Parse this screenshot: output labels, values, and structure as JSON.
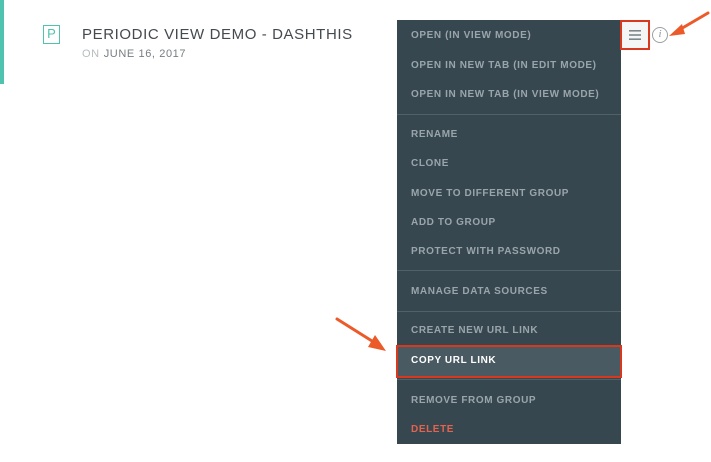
{
  "dashboard": {
    "letter": "P",
    "title": "PERIODIC VIEW DEMO - DASHTHIS",
    "date_prefix": "ON",
    "date": "JUNE 16, 2017"
  },
  "actions": {
    "menu_icon": "hamburger-menu-icon",
    "info_icon": "info-icon",
    "info_glyph": "i"
  },
  "menu": {
    "groups": [
      [
        "OPEN (IN VIEW MODE)",
        "OPEN IN NEW TAB (IN EDIT MODE)",
        "OPEN IN NEW TAB (IN VIEW MODE)"
      ],
      [
        "RENAME",
        "CLONE",
        "MOVE TO DIFFERENT GROUP",
        "ADD TO GROUP",
        "PROTECT WITH PASSWORD"
      ],
      [
        "MANAGE DATA SOURCES"
      ],
      [
        "CREATE NEW URL LINK",
        "COPY URL LINK"
      ],
      [
        "REMOVE FROM GROUP",
        "DELETE"
      ]
    ],
    "selected": "COPY URL LINK",
    "danger": "DELETE"
  },
  "colors": {
    "accent": "#4fc3b0",
    "menu_bg": "#37474f",
    "annotation_red": "#d8381e",
    "danger": "#e2634f"
  }
}
